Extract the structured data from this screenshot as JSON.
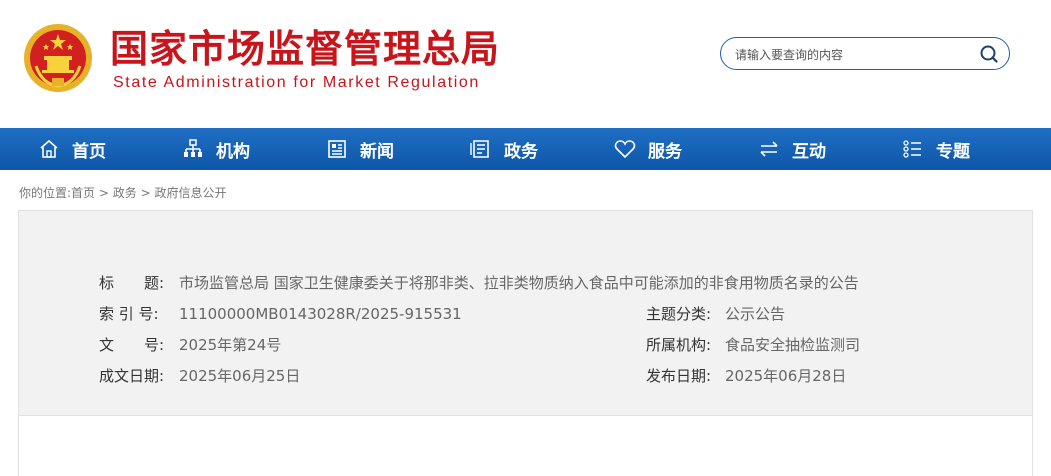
{
  "header": {
    "title": "国家市场监督管理总局",
    "subtitle": "State Administration for Market Regulation",
    "emblem_icon": "national-emblem-icon"
  },
  "search": {
    "placeholder": "请输入要查询的内容",
    "icon": "search-icon"
  },
  "nav": {
    "items": [
      {
        "label": "首页",
        "icon": "home-icon"
      },
      {
        "label": "机构",
        "icon": "org-chart-icon"
      },
      {
        "label": "新闻",
        "icon": "news-icon"
      },
      {
        "label": "政务",
        "icon": "document-icon"
      },
      {
        "label": "服务",
        "icon": "heart-icon"
      },
      {
        "label": "互动",
        "icon": "swap-arrows-icon"
      },
      {
        "label": "专题",
        "icon": "list-icon"
      }
    ]
  },
  "breadcrumb": {
    "prefix": "你的位置:",
    "items": [
      "首页",
      "政务",
      "政府信息公开"
    ],
    "separator": ">"
  },
  "info": {
    "title_label": "标　　题:",
    "title_value": "市场监管总局 国家卫生健康委关于将那非类、拉非类物质纳入食品中可能添加的非食用物质名录的公告",
    "index_label": "索 引 号:",
    "index_value": "11100000MB0143028R/2025-915531",
    "topic_label": "主题分类:",
    "topic_value": "公示公告",
    "docno_label": "文　　号:",
    "docno_value": "2025年第24号",
    "org_label": "所属机构:",
    "org_value": "食品安全抽检监测司",
    "written_label": "成文日期:",
    "written_value": "2025年06月25日",
    "published_label": "发布日期:",
    "published_value": "2025年06月28日"
  },
  "colors": {
    "brand_red": "#c8141b",
    "nav_blue": "#0d56a8",
    "info_bg": "#f2f2f2"
  }
}
